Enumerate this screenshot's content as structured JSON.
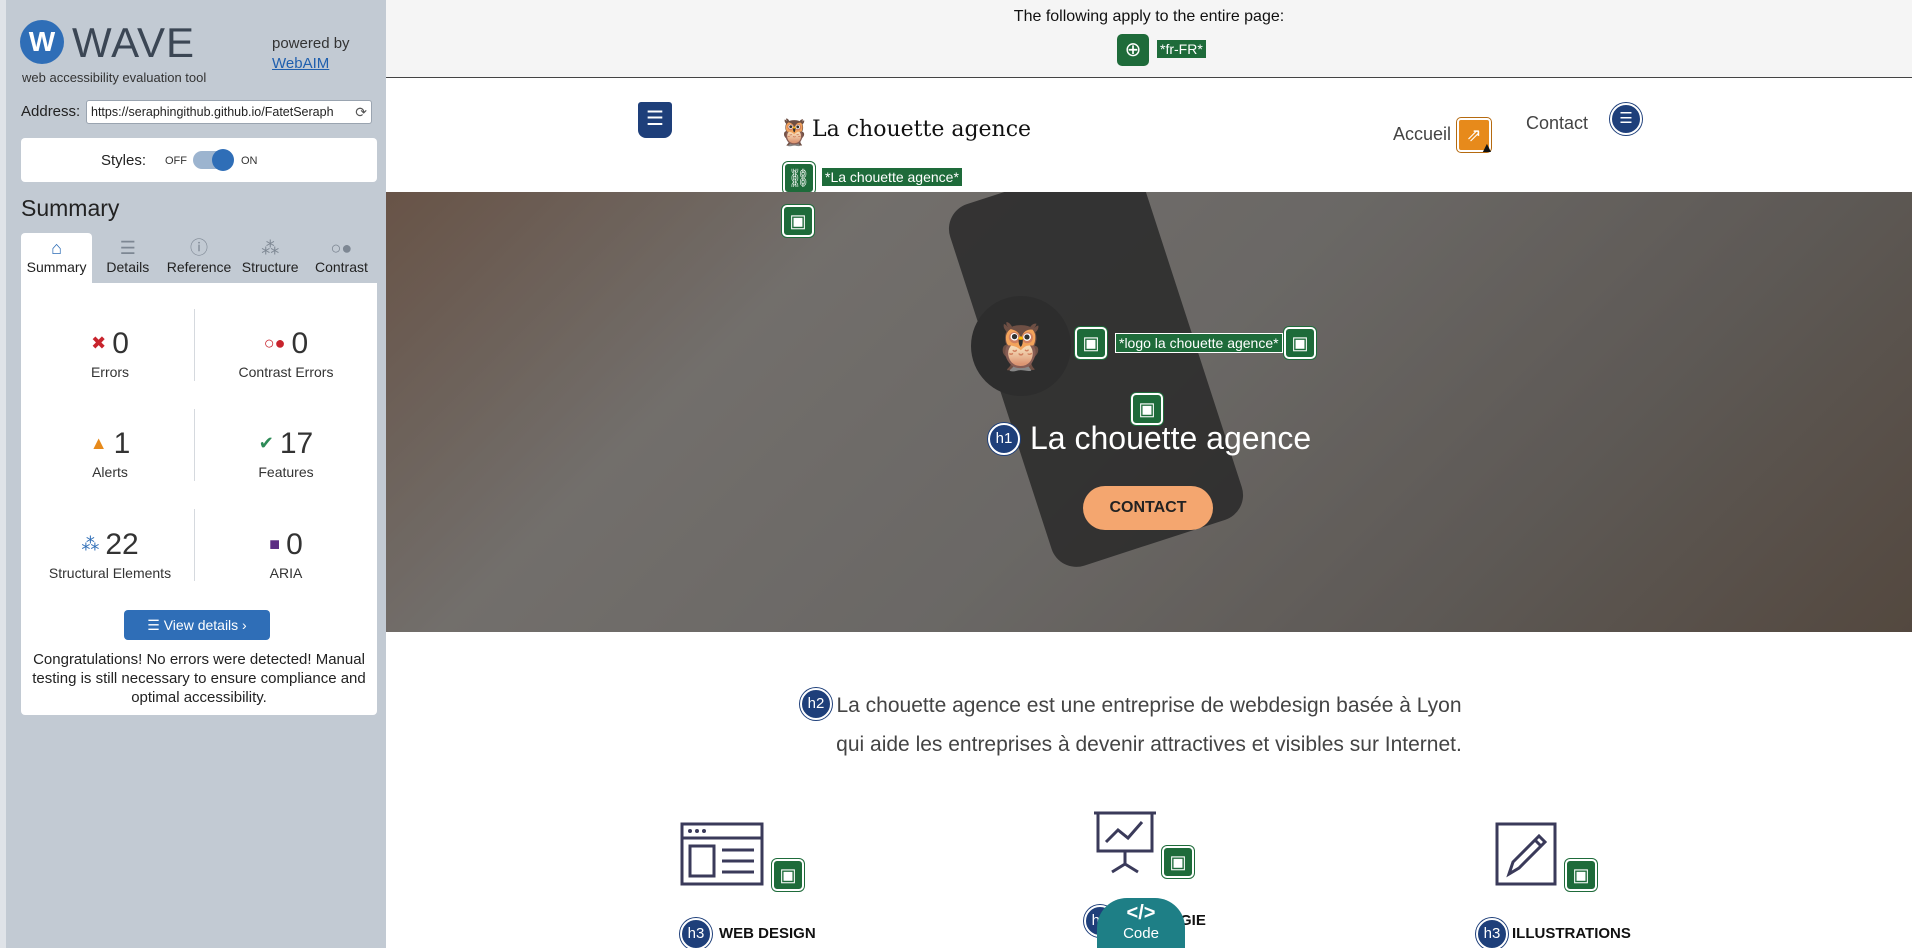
{
  "wave": {
    "title": "WAVE",
    "subtitle": "web accessibility evaluation tool",
    "powered_by": "powered by",
    "webaim": "WebAIM",
    "address_label": "Address:",
    "address_value": "https://seraphingithub.github.io/FatetSeraph",
    "styles_label": "Styles:",
    "styles_off": "OFF",
    "styles_on": "ON",
    "summary_heading": "Summary",
    "tabs": [
      {
        "label": "Summary",
        "icon": "home-icon"
      },
      {
        "label": "Details",
        "icon": "list-icon"
      },
      {
        "label": "Reference",
        "icon": "info-icon"
      },
      {
        "label": "Structure",
        "icon": "hierarchy-icon"
      },
      {
        "label": "Contrast",
        "icon": "contrast-icon"
      }
    ],
    "stats": {
      "errors": {
        "value": "0",
        "label": "Errors"
      },
      "contrast_errors": {
        "value": "0",
        "label": "Contrast Errors"
      },
      "alerts": {
        "value": "1",
        "label": "Alerts"
      },
      "features": {
        "value": "17",
        "label": "Features"
      },
      "structural": {
        "value": "22",
        "label": "Structural Elements"
      },
      "aria": {
        "value": "0",
        "label": "ARIA"
      }
    },
    "view_details": "View details ›",
    "congrats": "Congratulations! No errors were detected! Manual testing is still necessary to ensure compliance and optimal accessibility."
  },
  "page": {
    "page_info_text": "The following apply to the entire page:",
    "lang_label": "*fr-FR*",
    "brand": "La chouette agence",
    "link_label": "*La chouette agence*",
    "logo_alt_label": "*logo la chouette agence*",
    "nav": {
      "accueil": "Accueil",
      "contact": "Contact"
    },
    "hero_title": "La chouette agence",
    "hero_button": "CONTACT",
    "h1_badge": "h1",
    "h2_badge": "h2",
    "h3_badge": "h3",
    "intro_line1": "La chouette agence est une entreprise de webdesign basée à Lyon",
    "intro_line2": "qui aide les entreprises à devenir attractives et visibles sur Internet.",
    "features": [
      {
        "title": "WEB DESIGN"
      },
      {
        "title": "GIE"
      },
      {
        "title": "ILLUSTRATIONS"
      }
    ],
    "code_label": "Code"
  },
  "colors": {
    "wave_blue": "#2f6eb7",
    "feature_green": "#1e6b3a",
    "structure_navy": "#1e3f7a",
    "alert_orange": "#e78a1b",
    "hero_button": "#f4a66f"
  }
}
